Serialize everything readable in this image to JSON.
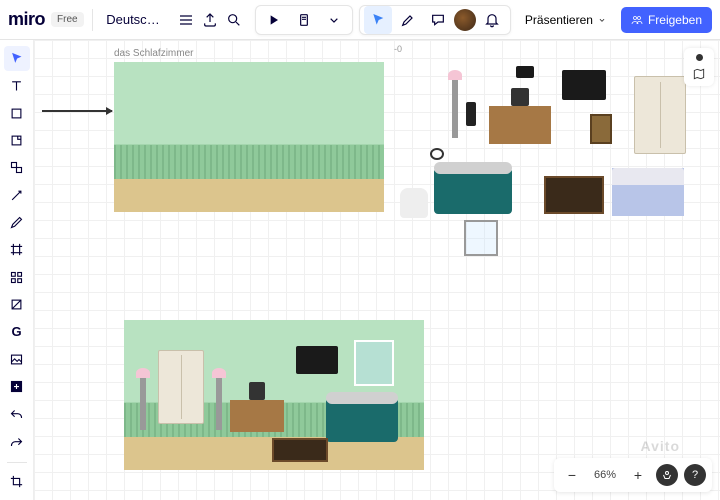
{
  "app": {
    "logo": "miro",
    "plan": "Free",
    "board_name": "Deutsch. Kinder"
  },
  "topbar": {
    "present_label": "Präsentieren",
    "share_label": "Freigeben"
  },
  "canvas": {
    "frame1_label": "das Schlafzimmer",
    "ruler_coord": "-0"
  },
  "zoom": {
    "percent": "66%"
  },
  "watermark": "Avito"
}
